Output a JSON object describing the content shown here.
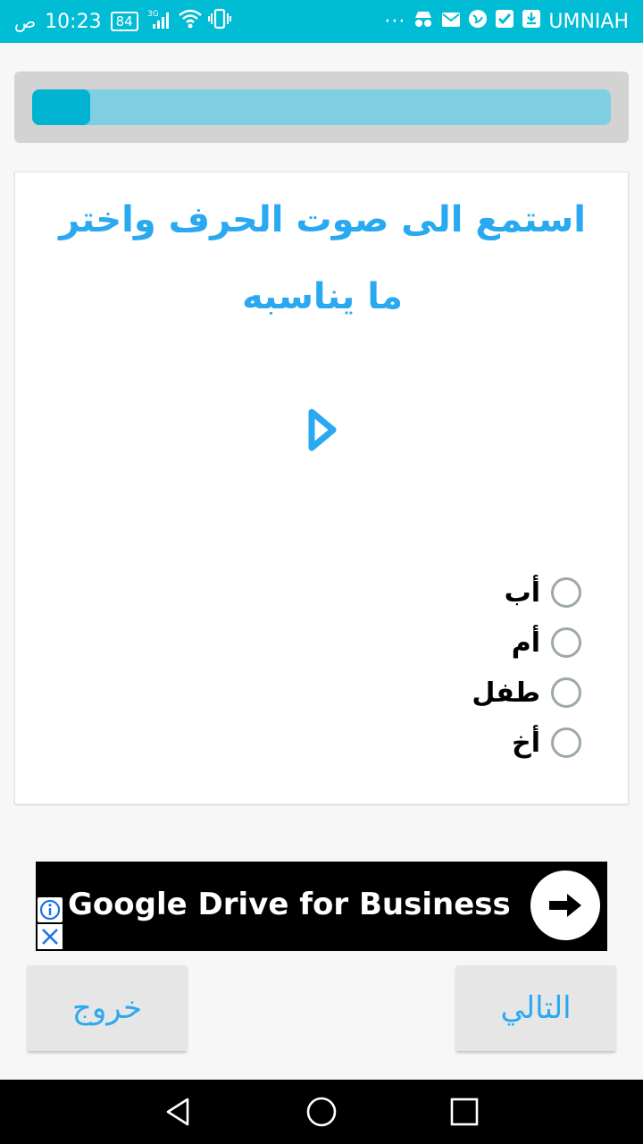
{
  "status_bar": {
    "time": "10:23",
    "ampm": "ص",
    "battery": "84",
    "network": "3G",
    "carrier": "UMNIAH",
    "overflow": "···",
    "icons_left": [
      "battery-icon",
      "signal-icon",
      "wifi-icon",
      "vibrate-icon"
    ],
    "icons_right": [
      "overflow-dots-icon",
      "incognito-icon",
      "mail-icon",
      "globe-icon",
      "checkbox-icon",
      "download-box-icon"
    ]
  },
  "progress": {
    "value_fraction": 0.1
  },
  "question": {
    "text": "استمع الى صوت الحرف واختر ما يناسبه",
    "play_icon": "play-icon"
  },
  "options": [
    {
      "label": "أب",
      "selected": false
    },
    {
      "label": "أم",
      "selected": false
    },
    {
      "label": "طفل",
      "selected": false
    },
    {
      "label": "أخ",
      "selected": false
    }
  ],
  "ad": {
    "title": "Google Drive for Business",
    "info_icon": "info-icon",
    "close_icon": "close-icon",
    "arrow_icon": "arrow-right-icon"
  },
  "buttons": {
    "exit_label": "خروج",
    "next_label": "التالي"
  },
  "nav": [
    "back-icon",
    "home-icon",
    "recents-icon"
  ],
  "colors": {
    "status_bar": "#00bcd4",
    "accent": "#29a9f0",
    "progress_fill": "#00b3d1",
    "progress_track": "#7fcfe3"
  }
}
